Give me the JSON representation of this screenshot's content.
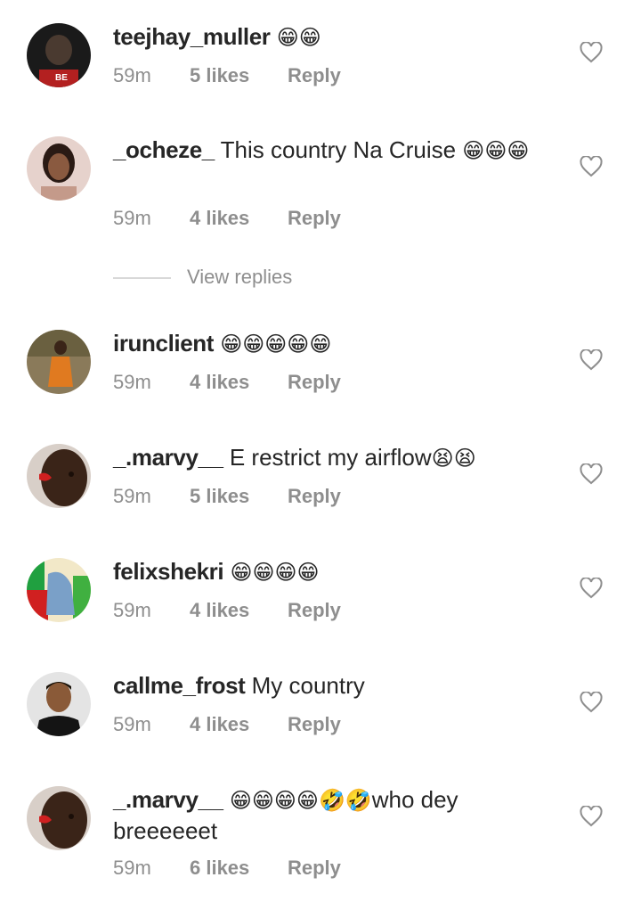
{
  "comments": [
    {
      "username": "teejhay_muller",
      "text": "",
      "emoji": "😁😁",
      "time": "59m",
      "likes": "5 likes",
      "reply": "Reply",
      "avatar": "avatar-boxer-icon"
    },
    {
      "username": "_ocheze_",
      "text": "This country Na Cruise",
      "emoji": "😁😁😁",
      "time": "59m",
      "likes": "4 likes",
      "reply": "Reply",
      "avatar": "avatar-woman-icon"
    },
    {
      "username": "irunclient",
      "text": "",
      "emoji": "😁😁😁😁😁",
      "time": "59m",
      "likes": "4 likes",
      "reply": "Reply",
      "avatar": "avatar-orange-outfit-icon"
    },
    {
      "username": "_.marvy__",
      "text": "E restrict my airflow",
      "emoji": "😫😫",
      "time": "59m",
      "likes": "5 likes",
      "reply": "Reply",
      "avatar": "avatar-face-paint-icon"
    },
    {
      "username": "felixshekri",
      "text": "",
      "emoji": "😁😁😁😁",
      "time": "59m",
      "likes": "4 likes",
      "reply": "Reply",
      "avatar": "avatar-colorful-art-icon"
    },
    {
      "username": "callme_frost",
      "text": "My country",
      "emoji": "",
      "time": "59m",
      "likes": "4 likes",
      "reply": "Reply",
      "avatar": "avatar-man-icon"
    },
    {
      "username": "_.marvy__",
      "text": "who dey breeeeeet",
      "emoji": "😁😁😁😁🤣🤣",
      "time": "59m",
      "likes": "6 likes",
      "reply": "Reply",
      "avatar": "avatar-face-paint-icon"
    }
  ],
  "view_replies": "View replies",
  "colors": {
    "secondary_text": "#8e8e8e",
    "primary_text": "#262626",
    "divider": "#d8d8d8"
  }
}
